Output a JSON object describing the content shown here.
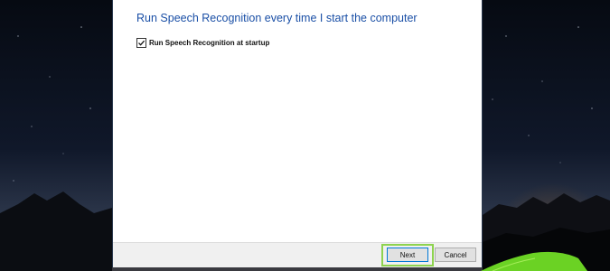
{
  "wizard": {
    "heading": "Run Speech Recognition every time I start the computer",
    "startup_option": {
      "label": "Run Speech Recognition at startup",
      "checked": true
    }
  },
  "footer": {
    "next_label": "Next",
    "cancel_label": "Cancel"
  },
  "colors": {
    "heading": "#1a4fa6",
    "highlight": "#8ed34f",
    "tent": "#6bd224"
  }
}
